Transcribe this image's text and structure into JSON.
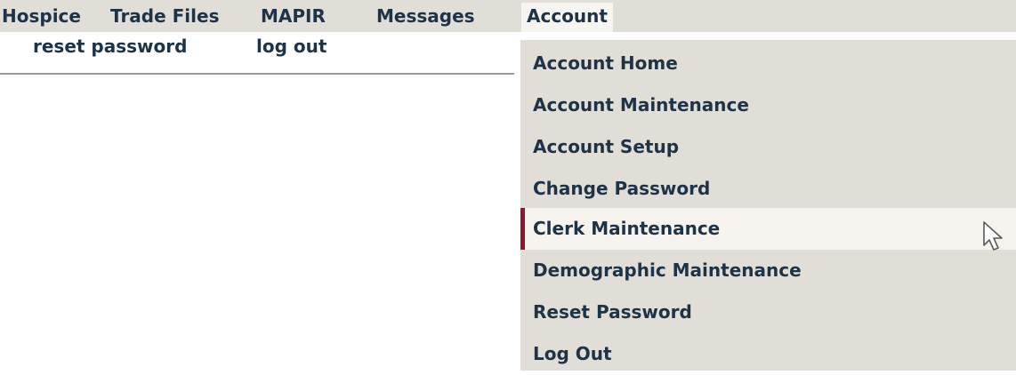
{
  "menubar": {
    "items": [
      {
        "label": "Hospice"
      },
      {
        "label": "Trade Files"
      },
      {
        "label": "MAPIR"
      },
      {
        "label": "Messages"
      },
      {
        "label": "Account"
      }
    ]
  },
  "submenu": {
    "links": [
      {
        "label": "reset password"
      },
      {
        "label": "log out"
      }
    ]
  },
  "dropdown": {
    "items": [
      {
        "label": "Account Home"
      },
      {
        "label": "Account Maintenance"
      },
      {
        "label": "Account Setup"
      },
      {
        "label": "Change Password"
      },
      {
        "label": "Clerk Maintenance"
      },
      {
        "label": "Demographic Maintenance"
      },
      {
        "label": "Reset Password"
      },
      {
        "label": "Log Out"
      }
    ],
    "hovered_item": "Clerk Maintenance"
  },
  "colors": {
    "menubar_bg": "#e1ddd7",
    "hover_bg": "#f6f3ef",
    "hover_accent": "#8c1a2c",
    "text": "#1f3346"
  },
  "icons": {
    "cursor": "mouse-pointer-icon"
  }
}
